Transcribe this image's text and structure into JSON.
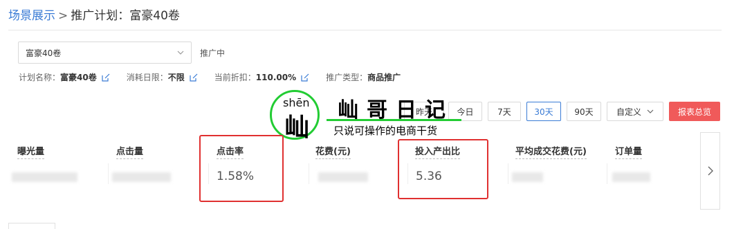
{
  "breadcrumb": {
    "parent": "场景展示",
    "separator": ">",
    "current": "推广计划：富豪40卷"
  },
  "plan": {
    "selected": "富豪40卷",
    "status": "推广中"
  },
  "meta": [
    {
      "label": "计划名称：",
      "value": "富豪40卷",
      "edit": true
    },
    {
      "label": "消耗日限：",
      "value": "不限",
      "edit": true
    },
    {
      "label": "当前折扣：",
      "value": "110.00%",
      "edit": true
    },
    {
      "label": "推广类型：",
      "value": "商品推广",
      "edit": false
    }
  ],
  "date_range": {
    "yesterday": "昨天",
    "today": "今日",
    "d7": "7天",
    "d30": "30天",
    "d90": "90天",
    "custom": "自定义",
    "active": "30天"
  },
  "report_button": "报表总览",
  "watermark": {
    "pinyin": "shēn",
    "char": "屾",
    "title": "屾哥日记",
    "subtitle": "只说可操作的电商干货"
  },
  "metrics": [
    {
      "label": "曝光量",
      "value": null
    },
    {
      "label": "点击量",
      "value": null
    },
    {
      "label": "点击率",
      "value": "1.58%"
    },
    {
      "label": "花费(元)",
      "value": null
    },
    {
      "label": "投入产出比",
      "value": "5.36"
    },
    {
      "label": "平均成交花费(元)",
      "value": null
    },
    {
      "label": "订单量",
      "value": null
    }
  ],
  "colors": {
    "link": "#3a7bd5",
    "report": "#f05a5a",
    "highlight": "#e03030",
    "watermark_green": "#22cc33"
  },
  "icons": {
    "edit": "edit-icon",
    "dropdown": "chevron-down-icon",
    "next": "chevron-right-icon"
  }
}
